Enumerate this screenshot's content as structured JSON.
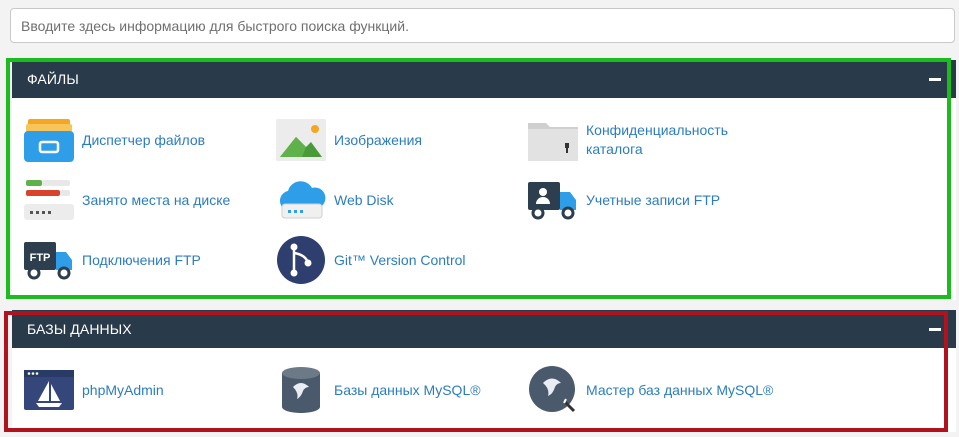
{
  "search": {
    "placeholder": "Вводите здесь информацию для быстрого поиска функций."
  },
  "files": {
    "title": "ФАЙЛЫ",
    "items": [
      {
        "label": "Диспетчер файлов",
        "icon": "file-manager-icon"
      },
      {
        "label": "Изображения",
        "icon": "images-icon"
      },
      {
        "label": "Конфиденциальность каталога",
        "icon": "directory-privacy-icon"
      },
      {
        "label": "Занято места на диске",
        "icon": "disk-usage-icon"
      },
      {
        "label": "Web Disk",
        "icon": "web-disk-icon"
      },
      {
        "label": "Учетные записи FTP",
        "icon": "ftp-accounts-icon"
      },
      {
        "label": "Подключения FTP",
        "icon": "ftp-connections-icon"
      },
      {
        "label": "Git™ Version Control",
        "icon": "git-icon"
      }
    ]
  },
  "databases": {
    "title": "БАЗЫ ДАННЫХ",
    "items": [
      {
        "label": "phpMyAdmin",
        "icon": "phpmyadmin-icon"
      },
      {
        "label": "Базы данных MySQL®",
        "icon": "mysql-databases-icon"
      },
      {
        "label": "Мастер баз данных MySQL®",
        "icon": "mysql-wizard-icon"
      }
    ]
  },
  "colors": {
    "header": "#293a4a",
    "link": "#2b7dc1",
    "highlight_green": "#1bbd1e",
    "highlight_red": "#b0121e"
  }
}
